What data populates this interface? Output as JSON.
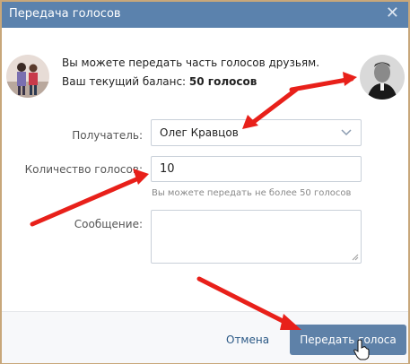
{
  "dialog": {
    "title": "Передача голосов",
    "close_glyph": "✕",
    "info_line1": "Вы можете передать часть голосов друзьям.",
    "balance_label": "Ваш текущий баланс:",
    "balance_value": "50 голосов"
  },
  "form": {
    "recipient_label": "Получатель:",
    "recipient_value": "Олег Кравцов",
    "count_label": "Количество голосов:",
    "count_value": "10",
    "count_hint": "Вы можете передать не более 50 голосов",
    "message_label": "Сообщение:"
  },
  "footer": {
    "cancel_label": "Отмена",
    "submit_label": "Передать голоса"
  },
  "colors": {
    "header": "#5b82ad",
    "button": "#5e81a8",
    "annotation_arrow": "#e8201a"
  }
}
